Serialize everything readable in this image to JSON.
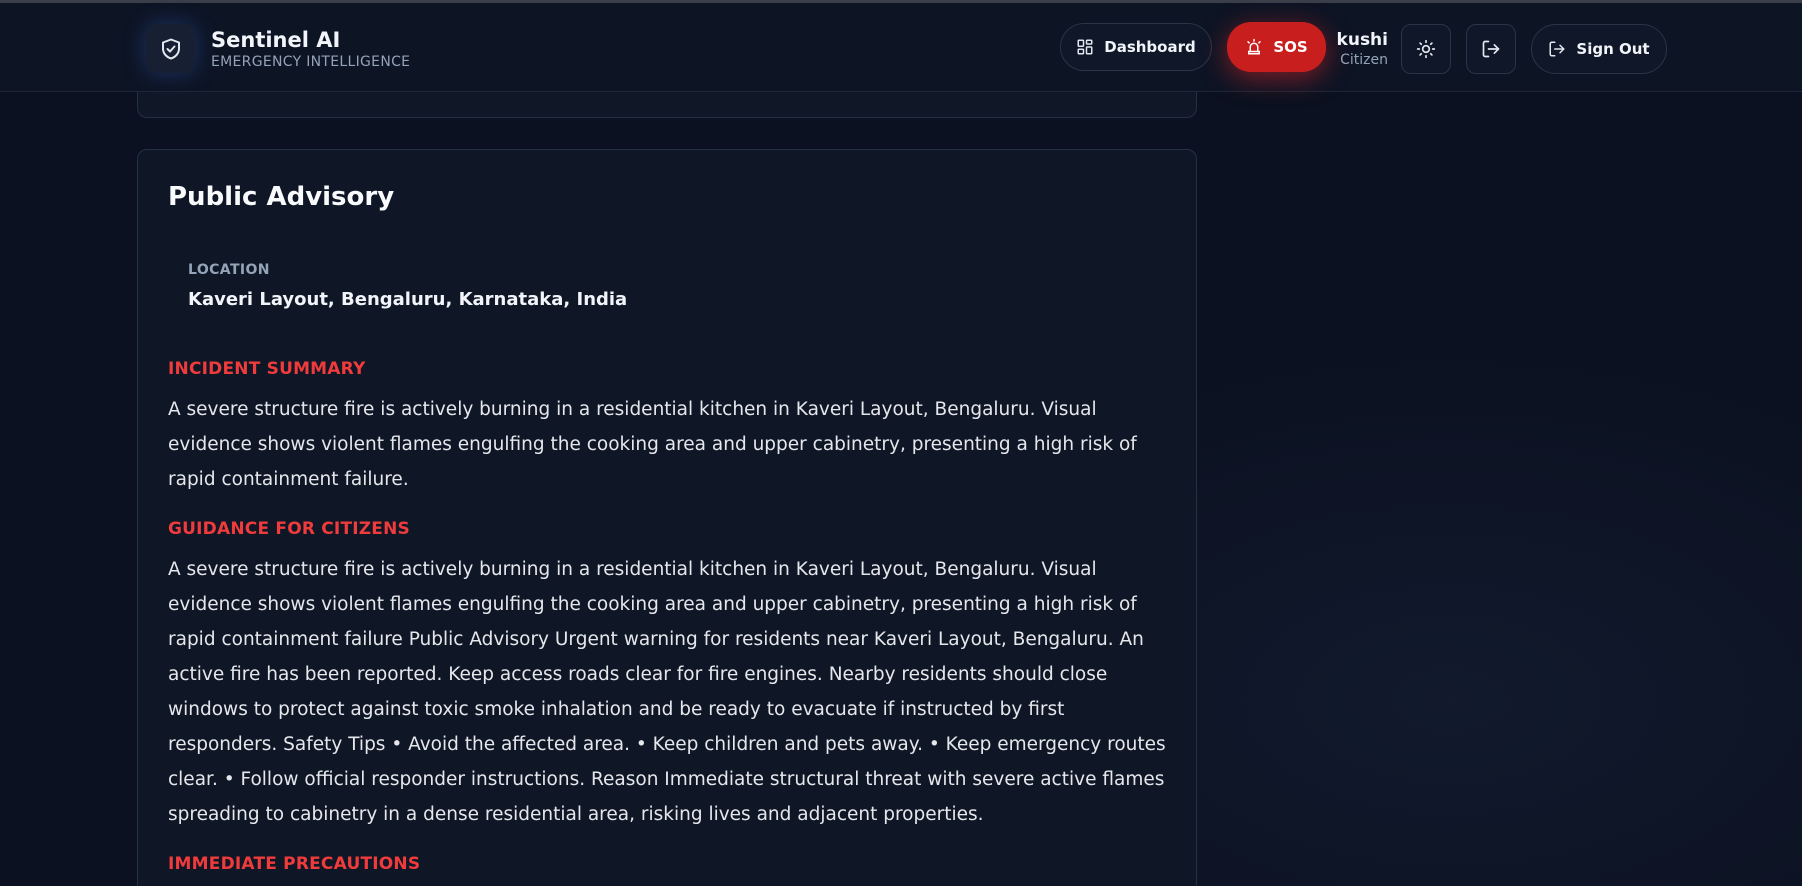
{
  "brand": {
    "name": "Sentinel AI",
    "subtitle": "EMERGENCY INTELLIGENCE",
    "logo_icon": "shield-check-icon"
  },
  "nav": {
    "dashboard_label": "Dashboard",
    "sos_label": "SOS",
    "signout_label": "Sign Out"
  },
  "user": {
    "name": "kushi",
    "role": "Citizen"
  },
  "advisory": {
    "title": "Public Advisory",
    "location_label": "LOCATION",
    "location_value": "Kaveri Layout, Bengaluru, Karnataka, India",
    "sections": [
      {
        "heading": "INCIDENT SUMMARY",
        "body": "A severe structure fire is actively burning in a residential kitchen in Kaveri Layout, Bengaluru. Visual evidence shows violent flames engulfing the cooking area and upper cabinetry, presenting a high risk of rapid containment failure."
      },
      {
        "heading": "GUIDANCE FOR CITIZENS",
        "body": "A severe structure fire is actively burning in a residential kitchen in Kaveri Layout, Bengaluru. Visual evidence shows violent flames engulfing the cooking area and upper cabinetry, presenting a high risk of rapid containment failure Public Advisory Urgent warning for residents near Kaveri Layout, Bengaluru. An active fire has been reported. Keep access roads clear for fire engines. Nearby residents should close windows to protect against toxic smoke inhalation and be ready to evacuate if instructed by first responders. Safety Tips • Avoid the affected area. • Keep children and pets away. • Keep emergency routes clear. • Follow official responder instructions. Reason Immediate structural threat with severe active flames spreading to cabinetry in a dense residential area, risking lives and adjacent properties."
      },
      {
        "heading": "IMMEDIATE PRECAUTIONS",
        "body": ""
      }
    ]
  },
  "colors": {
    "background": "#0b1120",
    "accent_red": "#c81e1e",
    "section_heading": "#ef3b3b"
  }
}
